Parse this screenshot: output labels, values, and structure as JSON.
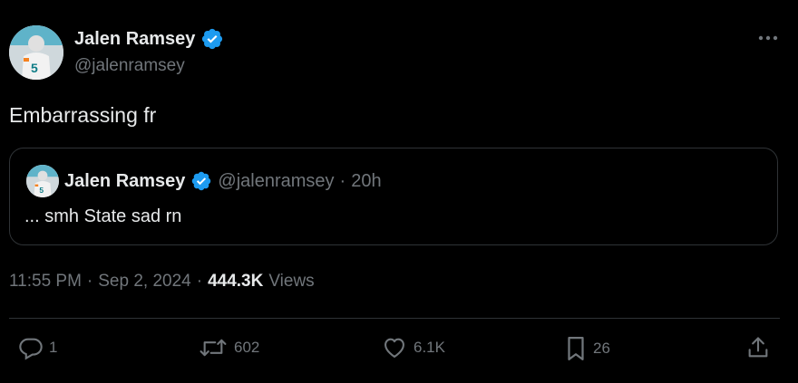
{
  "author": {
    "display_name": "Jalen Ramsey",
    "handle": "@jalenramsey",
    "verified": true
  },
  "tweet": {
    "text": "Embarrassing fr"
  },
  "quoted_tweet": {
    "display_name": "Jalen Ramsey",
    "handle": "@jalenramsey",
    "separator": "·",
    "time": "20h",
    "text": "... smh State sad rn"
  },
  "meta": {
    "time": "11:55 PM",
    "separator": "·",
    "date": "Sep 2, 2024",
    "separator2": "·",
    "views_count": "444.3K",
    "views_label": "Views"
  },
  "actions": {
    "replies": "1",
    "reposts": "602",
    "likes": "6.1K",
    "bookmarks": "26"
  },
  "colors": {
    "background": "#000000",
    "text_primary": "#e7e9ea",
    "text_secondary": "#71767b",
    "border": "#2f3336",
    "verified_blue": "#1d9bf0"
  }
}
